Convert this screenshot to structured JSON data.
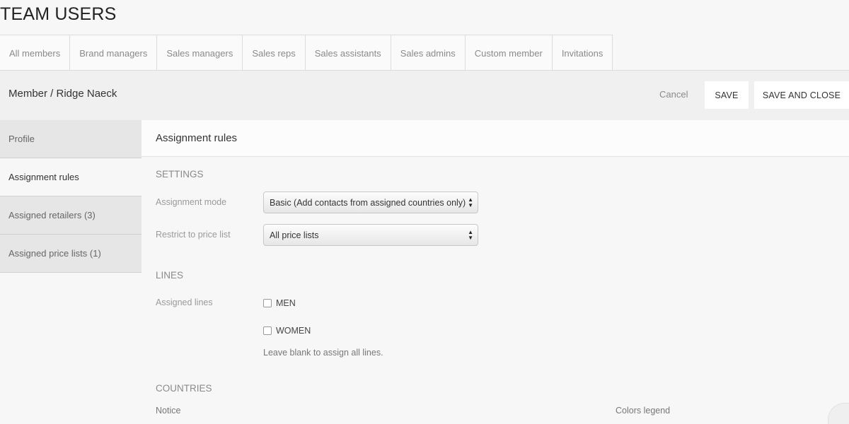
{
  "page": {
    "title": "TEAM USERS"
  },
  "tabs": [
    {
      "label": "All members"
    },
    {
      "label": "Brand managers"
    },
    {
      "label": "Sales managers"
    },
    {
      "label": "Sales reps"
    },
    {
      "label": "Sales assistants"
    },
    {
      "label": "Sales admins"
    },
    {
      "label": "Custom member"
    },
    {
      "label": "Invitations"
    }
  ],
  "member_bar": {
    "title": "Member / Ridge Naeck",
    "cancel_label": "Cancel",
    "save_label": "SAVE",
    "save_close_label": "SAVE AND CLOSE"
  },
  "sidebar": {
    "items": [
      {
        "label": "Profile"
      },
      {
        "label": "Assignment rules",
        "active": true
      },
      {
        "label": "Assigned retailers (3)"
      },
      {
        "label": "Assigned price lists (1)"
      }
    ]
  },
  "main": {
    "header": "Assignment rules",
    "settings": {
      "heading": "SETTINGS",
      "assignment_mode_label": "Assignment mode",
      "assignment_mode_value": "Basic (Add contacts from assigned countries only)",
      "price_list_label": "Restrict to price list",
      "price_list_value": "All price lists"
    },
    "lines": {
      "heading": "LINES",
      "assigned_lines_label": "Assigned lines",
      "options": [
        {
          "label": "MEN",
          "checked": false
        },
        {
          "label": "WOMEN",
          "checked": false
        }
      ],
      "hint": "Leave blank to assign all lines."
    },
    "countries": {
      "heading": "COUNTRIES",
      "notice_label": "Notice",
      "legend_label": "Colors legend"
    }
  }
}
